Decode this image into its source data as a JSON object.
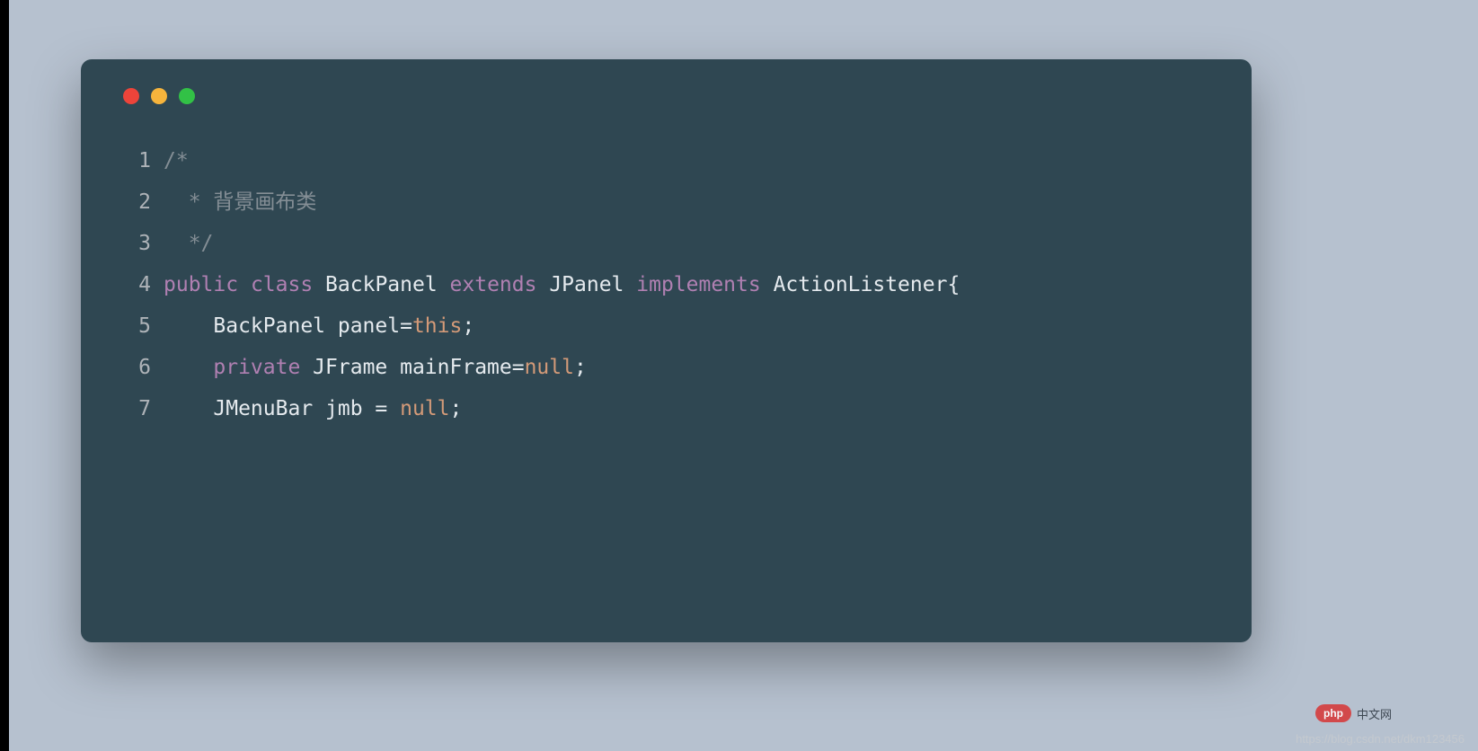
{
  "editor": {
    "theme": {
      "background": "#2f4752",
      "comment": "#848e95",
      "keyword": "#b080b2",
      "literal": "#d39a78",
      "default": "#e5eaee"
    },
    "lines": [
      {
        "num": "1",
        "tokens": [
          {
            "cls": "tok-comment",
            "text": "/*"
          }
        ]
      },
      {
        "num": "2",
        "tokens": [
          {
            "cls": "tok-comment",
            "text": "  * 背景画布类"
          }
        ]
      },
      {
        "num": "3",
        "tokens": [
          {
            "cls": "tok-comment",
            "text": "  */"
          }
        ]
      },
      {
        "num": "4",
        "tokens": [
          {
            "cls": "tok-keyword",
            "text": "public"
          },
          {
            "cls": "tok-ident",
            "text": " "
          },
          {
            "cls": "tok-keyword",
            "text": "class"
          },
          {
            "cls": "tok-ident",
            "text": " BackPanel "
          },
          {
            "cls": "tok-keyword",
            "text": "extends"
          },
          {
            "cls": "tok-ident",
            "text": " JPanel "
          },
          {
            "cls": "tok-keyword",
            "text": "implements"
          },
          {
            "cls": "tok-ident",
            "text": " ActionListener"
          },
          {
            "cls": "tok-punc",
            "text": "{"
          }
        ]
      },
      {
        "num": "5",
        "tokens": [
          {
            "cls": "tok-ident",
            "text": "    BackPanel panel="
          },
          {
            "cls": "tok-opkey",
            "text": "this"
          },
          {
            "cls": "tok-punc",
            "text": ";"
          }
        ]
      },
      {
        "num": "6",
        "tokens": [
          {
            "cls": "tok-ident",
            "text": "    "
          },
          {
            "cls": "tok-keyword",
            "text": "private"
          },
          {
            "cls": "tok-ident",
            "text": " JFrame mainFrame="
          },
          {
            "cls": "tok-opkey",
            "text": "null"
          },
          {
            "cls": "tok-punc",
            "text": ";"
          }
        ]
      },
      {
        "num": "7",
        "tokens": [
          {
            "cls": "tok-ident",
            "text": "    JMenuBar jmb = "
          },
          {
            "cls": "tok-opkey",
            "text": "null"
          },
          {
            "cls": "tok-punc",
            "text": ";"
          }
        ]
      }
    ]
  },
  "watermark": {
    "logo_text": "php",
    "logo_label": "中文网",
    "url": "https://blog.csdn.net/dkm123456"
  }
}
